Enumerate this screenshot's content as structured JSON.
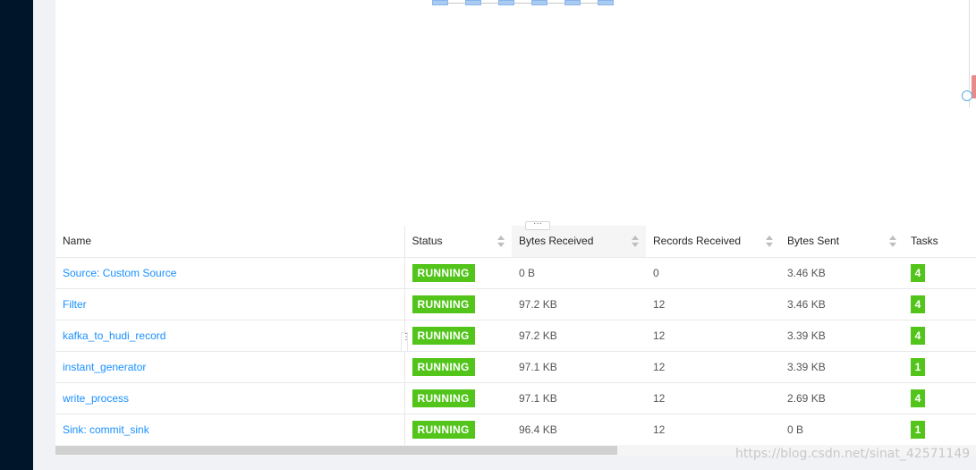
{
  "table": {
    "columns": [
      "Name",
      "Status",
      "Bytes Received",
      "Records Received",
      "Bytes Sent",
      "Tasks"
    ],
    "rows": [
      {
        "name": "Source: Custom Source",
        "status": "RUNNING",
        "bytes_received": "0 B",
        "records_received": "0",
        "bytes_sent": "3.46 KB",
        "tasks": "4"
      },
      {
        "name": "Filter",
        "status": "RUNNING",
        "bytes_received": "97.2 KB",
        "records_received": "12",
        "bytes_sent": "3.46 KB",
        "tasks": "4"
      },
      {
        "name": "kafka_to_hudi_record",
        "status": "RUNNING",
        "bytes_received": "97.2 KB",
        "records_received": "12",
        "bytes_sent": "3.39 KB",
        "tasks": "4"
      },
      {
        "name": "instant_generator",
        "status": "RUNNING",
        "bytes_received": "97.1 KB",
        "records_received": "12",
        "bytes_sent": "3.39 KB",
        "tasks": "1"
      },
      {
        "name": "write_process",
        "status": "RUNNING",
        "bytes_received": "97.1 KB",
        "records_received": "12",
        "bytes_sent": "2.69 KB",
        "tasks": "4"
      },
      {
        "name": "Sink: commit_sink",
        "status": "RUNNING",
        "bytes_received": "96.4 KB",
        "records_received": "12",
        "bytes_sent": "0 B",
        "tasks": "1"
      }
    ]
  },
  "colors": {
    "status_running": "#52c41a",
    "link": "#1890ff",
    "sidebar": "#001529"
  },
  "icons": {
    "resize_handle": "ellipsis-icon",
    "sort": "sort-caret-icon"
  },
  "watermark": "https://blog.csdn.net/sinat_42571149"
}
